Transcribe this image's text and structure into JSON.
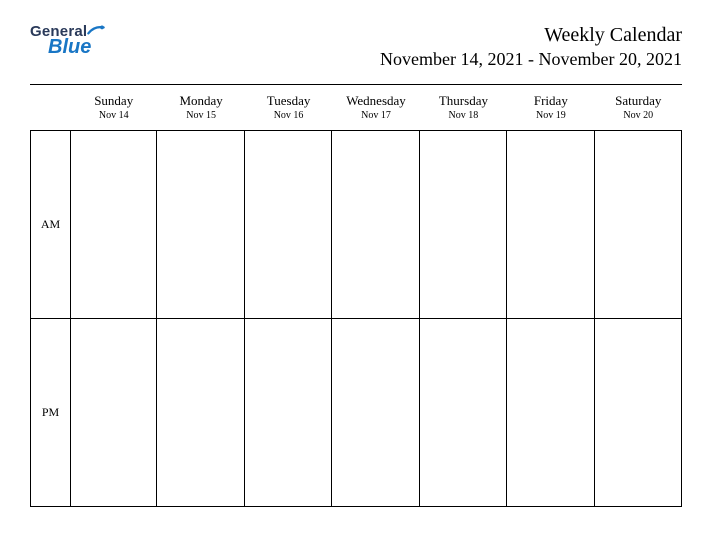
{
  "logo": {
    "line1": "General",
    "line2": "Blue"
  },
  "header": {
    "title": "Weekly Calendar",
    "subtitle": "November 14, 2021 - November 20, 2021"
  },
  "days": [
    {
      "name": "Sunday",
      "date": "Nov 14"
    },
    {
      "name": "Monday",
      "date": "Nov 15"
    },
    {
      "name": "Tuesday",
      "date": "Nov 16"
    },
    {
      "name": "Wednesday",
      "date": "Nov 17"
    },
    {
      "name": "Thursday",
      "date": "Nov 18"
    },
    {
      "name": "Friday",
      "date": "Nov 19"
    },
    {
      "name": "Saturday",
      "date": "Nov 20"
    }
  ],
  "periods": {
    "am": "AM",
    "pm": "PM"
  }
}
